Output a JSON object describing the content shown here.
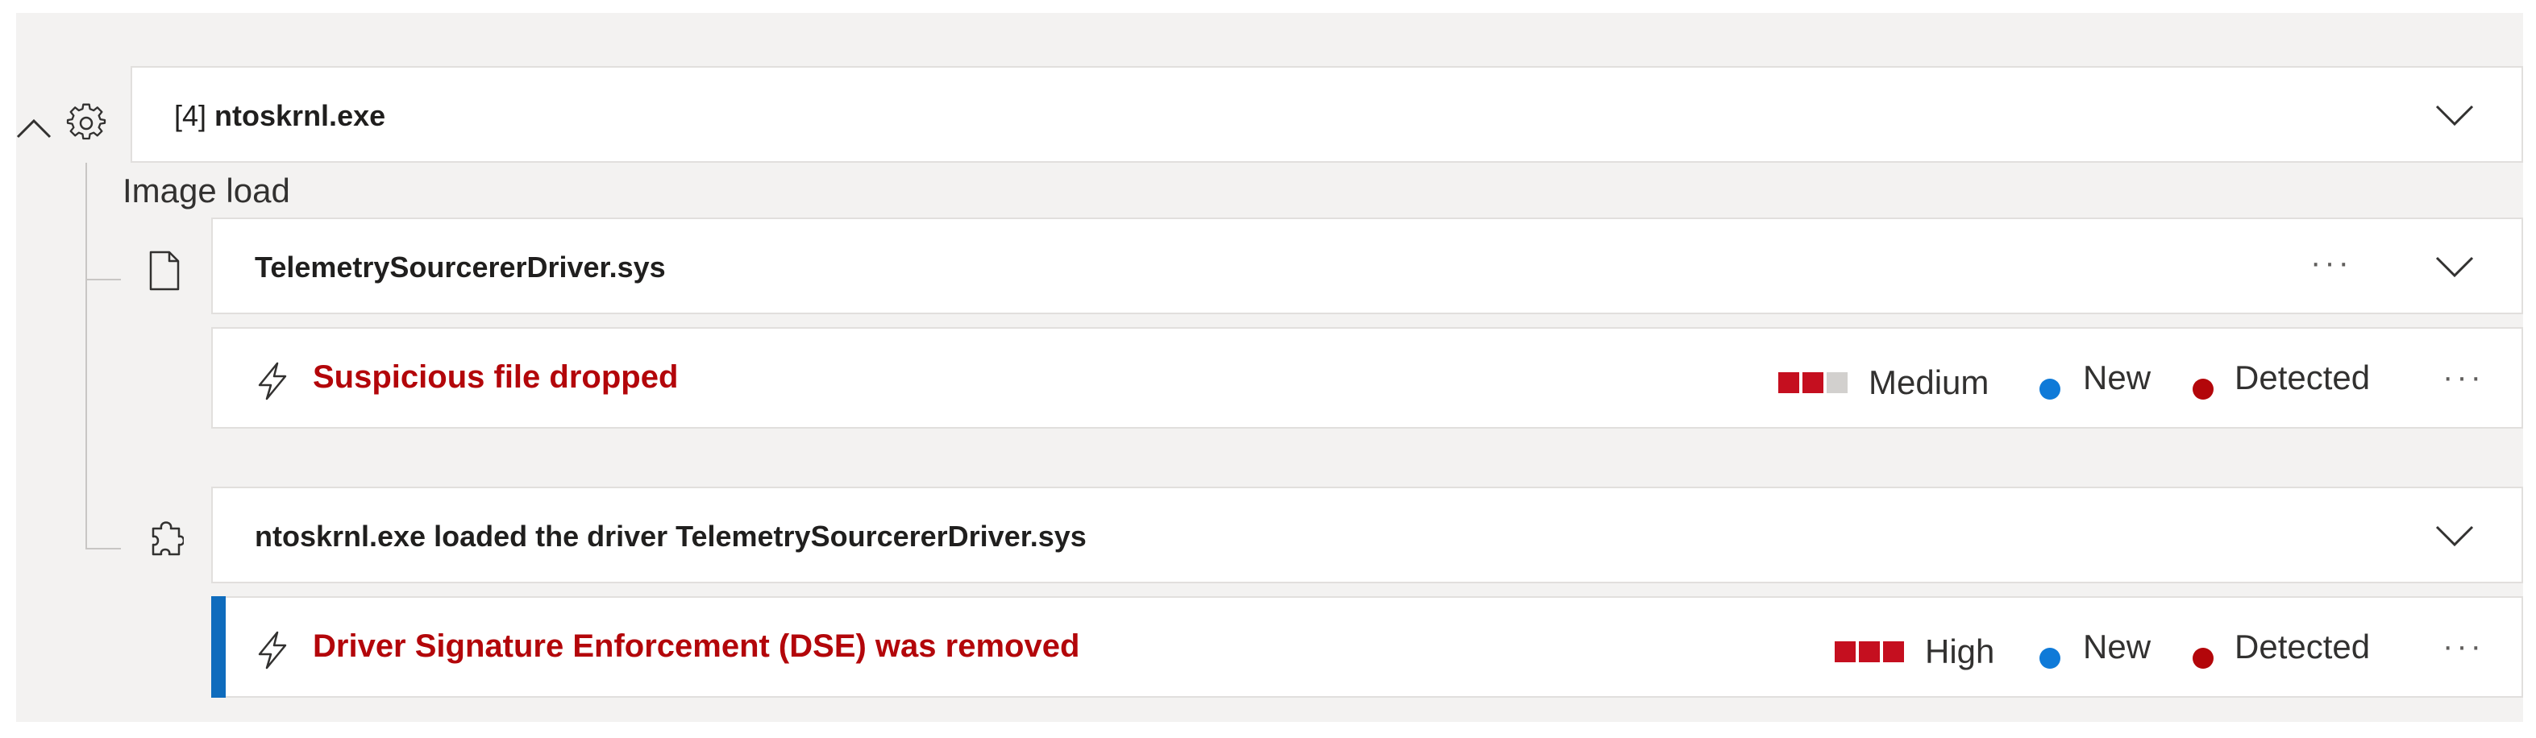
{
  "process": {
    "pid_label": "[4]",
    "name": "ntoskrnl.exe"
  },
  "section": {
    "label": "Image load"
  },
  "file_item": {
    "name": "TelemetrySourcererDriver.sys"
  },
  "alert1": {
    "title": "Suspicious file dropped",
    "severity_label": "Medium",
    "severity_level": 2,
    "severity_max": 3,
    "status_label": "New",
    "detection_label": "Detected"
  },
  "driver_item": {
    "text": "ntoskrnl.exe loaded the driver TelemetrySourcererDriver.sys"
  },
  "alert2": {
    "title": "Driver Signature Enforcement (DSE) was removed",
    "severity_label": "High",
    "severity_level": 3,
    "severity_max": 3,
    "status_label": "New",
    "detection_label": "Detected"
  },
  "colors": {
    "severity_filled": "#c50f1f",
    "severity_empty": "#d2d0ce",
    "status_new": "#0f7ad8",
    "status_detected": "#b3060a",
    "selected_accent": "#0f6cbd"
  }
}
